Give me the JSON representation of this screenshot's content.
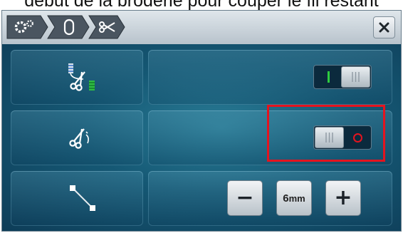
{
  "caption": {
    "text": "début de la broderie pour couper le fil restant"
  },
  "header": {
    "breadcrumb": [
      {
        "icon": "settings-icon"
      },
      {
        "icon": "bobbin-icon"
      },
      {
        "icon": "scissors-icon"
      }
    ],
    "close_icon": "close-icon"
  },
  "rows": [
    {
      "icon": "thread-cut-icon",
      "control": "toggle",
      "state": "on",
      "on_label": "I",
      "off_label": "|||"
    },
    {
      "icon": "jump-stitch-cut-icon",
      "control": "toggle",
      "state": "off",
      "on_label": "|||",
      "off_label": "O",
      "highlighted": true
    },
    {
      "icon": "jump-stitch-length-icon",
      "control": "stepper",
      "minus_label": "−",
      "value": "6",
      "unit": "mm",
      "plus_label": "+"
    }
  ],
  "colors": {
    "accent_on": "#2ecc40",
    "accent_off": "#e4141f",
    "highlight": "#e4141f"
  }
}
